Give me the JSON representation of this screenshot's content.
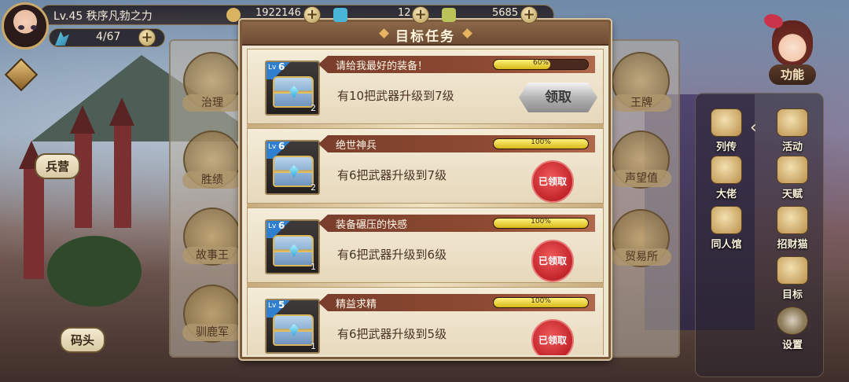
{
  "player": {
    "level_title": "Lv.45  秩序凡勃之力",
    "stamina": "4/67"
  },
  "resources": [
    {
      "name": "coin",
      "value": "1922146",
      "icon": "coin-icon",
      "color": "#d8b460"
    },
    {
      "name": "gem",
      "value": "12",
      "icon": "crystal-icon",
      "color": "#49b6d8"
    },
    {
      "name": "medal",
      "value": "5685",
      "icon": "medal-icon",
      "color": "#b9c35a"
    }
  ],
  "left_places": {
    "barracks": "兵营",
    "dock": "码头"
  },
  "bg_buildings_left": [
    "治理",
    "胜绩",
    "故事王",
    "驯鹿军"
  ],
  "bg_buildings_right": [
    "王牌",
    "声望值",
    "贸易所"
  ],
  "function_label": "功能",
  "side_menu": [
    "列传",
    "活动",
    "大佬",
    "天赋",
    "同人馆",
    "招财猫",
    "目标",
    "设置"
  ],
  "modal": {
    "title": "目标任务",
    "tasks": [
      {
        "title": "请给我最好的装备！",
        "progress_text": "60%",
        "progress": 0.6,
        "desc": "有10把武器升级到7级",
        "chest_level": "6",
        "qty": "2",
        "action": "领取",
        "claimed": false
      },
      {
        "title": "绝世神兵",
        "progress_text": "100%",
        "progress": 1.0,
        "desc": "有6把武器升级到7级",
        "chest_level": "6",
        "qty": "2",
        "action": "已领取",
        "claimed": true
      },
      {
        "title": "装备碾压的快感",
        "progress_text": "100%",
        "progress": 1.0,
        "desc": "有6把武器升级到6级",
        "chest_level": "6",
        "qty": "1",
        "action": "已领取",
        "claimed": true
      },
      {
        "title": "精益求精",
        "progress_text": "100%",
        "progress": 1.0,
        "desc": "有6把武器升级到5级",
        "chest_level": "5",
        "qty": "1",
        "action": "已领取",
        "claimed": true
      }
    ]
  },
  "lv_prefix": "Lv"
}
